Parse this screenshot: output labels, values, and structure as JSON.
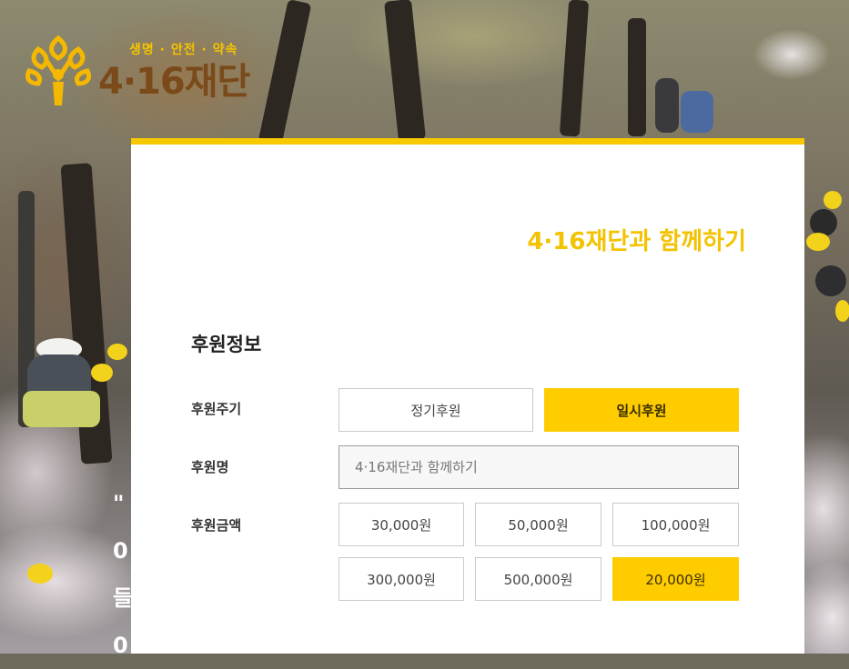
{
  "logo": {
    "tagline": "생명 · 안전 · 약속",
    "name": "4·16재단"
  },
  "background_text": [
    "\"",
    "0",
    "들",
    "0"
  ],
  "card": {
    "title": "4·16재단과 함께하기",
    "section_title": "후원정보",
    "period": {
      "label": "후원주기",
      "options": [
        {
          "label": "정기후원",
          "selected": false
        },
        {
          "label": "일시후원",
          "selected": true
        }
      ]
    },
    "name": {
      "label": "후원명",
      "placeholder": "4·16재단과 함께하기"
    },
    "amount": {
      "label": "후원금액",
      "options": [
        {
          "label": "30,000원",
          "selected": false
        },
        {
          "label": "50,000원",
          "selected": false
        },
        {
          "label": "100,000원",
          "selected": false
        },
        {
          "label": "300,000원",
          "selected": false
        },
        {
          "label": "500,000원",
          "selected": false
        },
        {
          "label": "20,000원",
          "selected": true
        }
      ]
    }
  },
  "colors": {
    "accent": "#ffcc00",
    "title": "#f3c200",
    "logo_brown": "#7a4a1a"
  }
}
